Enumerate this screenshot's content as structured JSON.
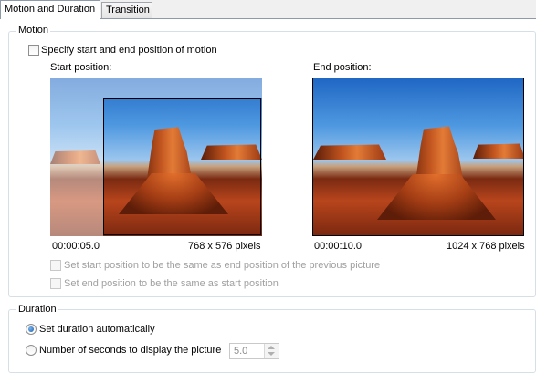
{
  "tabs": [
    {
      "label": "Motion and Duration"
    },
    {
      "label": "Transition"
    }
  ],
  "motion": {
    "group_title": "Motion",
    "specify_checkbox_label": "Specify start and end position of motion",
    "start_label": "Start position:",
    "end_label": "End position:",
    "start_time": "00:00:05.0",
    "start_size": "768 x 576 pixels",
    "end_time": "00:00:10.0",
    "end_size": "1024 x 768 pixels",
    "option_same_as_prev": "Set start position to be the same as end position of the previous picture",
    "option_end_same_as_start": "Set end position to be the same as start position"
  },
  "duration": {
    "group_title": "Duration",
    "auto_label": "Set duration automatically",
    "seconds_label": "Number of seconds to display the picture",
    "seconds_value": "5.0"
  }
}
